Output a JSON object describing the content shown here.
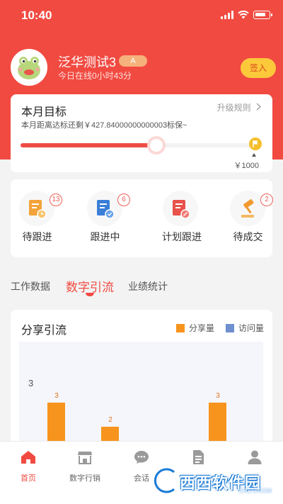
{
  "status_bar": {
    "time": "10:40"
  },
  "profile": {
    "name": "泛华测试3",
    "level": "A",
    "online_text": "今日在线0小时43分",
    "checkin_label": "签入"
  },
  "goal": {
    "title": "本月目标",
    "upgrade_label": "升级规则",
    "remaining_text": "本月距离达标还剩￥427.84000000000003标保~",
    "progress_fraction": 0.59,
    "target_text": "￥1000"
  },
  "follow_status": [
    {
      "label": "待跟进",
      "count": "13",
      "icon": "pending-followup-icon",
      "color": "#f3a33a"
    },
    {
      "label": "跟进中",
      "count": "6",
      "icon": "in-progress-icon",
      "color": "#3b7ed8"
    },
    {
      "label": "计划跟进",
      "count": "",
      "icon": "planned-followup-icon",
      "color": "#e8524a"
    },
    {
      "label": "待成交",
      "count": "2",
      "icon": "pending-deal-icon",
      "color": "#f09a2e"
    }
  ],
  "tabs": {
    "work_data": "工作数据",
    "digital_traffic": "数字引流",
    "performance": "业绩统计"
  },
  "chart_data": {
    "type": "bar",
    "title": "分享引流",
    "series": [
      {
        "name": "分享量",
        "color": "#f7941d",
        "values": [
          3,
          2,
          0,
          3,
          0,
          0
        ]
      },
      {
        "name": "访问量",
        "color": "#6f8fcf",
        "values": [
          1,
          0,
          0,
          0,
          0,
          0
        ]
      }
    ],
    "y_ticks": [
      "3"
    ],
    "visible_value_labels": {
      "share": [
        "3",
        "2",
        "3"
      ],
      "visit": [
        "1"
      ]
    }
  },
  "tabbar": [
    {
      "label": "首页",
      "icon": "home-icon",
      "active": true
    },
    {
      "label": "数字行销",
      "icon": "store-icon",
      "active": false
    },
    {
      "label": "会话",
      "icon": "chat-icon",
      "active": false
    },
    {
      "label": "",
      "icon": "document-icon",
      "active": false
    },
    {
      "label": "",
      "icon": "profile-icon",
      "active": false
    }
  ],
  "watermark": {
    "text": "西西软件园",
    "site": "CR173.COM"
  }
}
